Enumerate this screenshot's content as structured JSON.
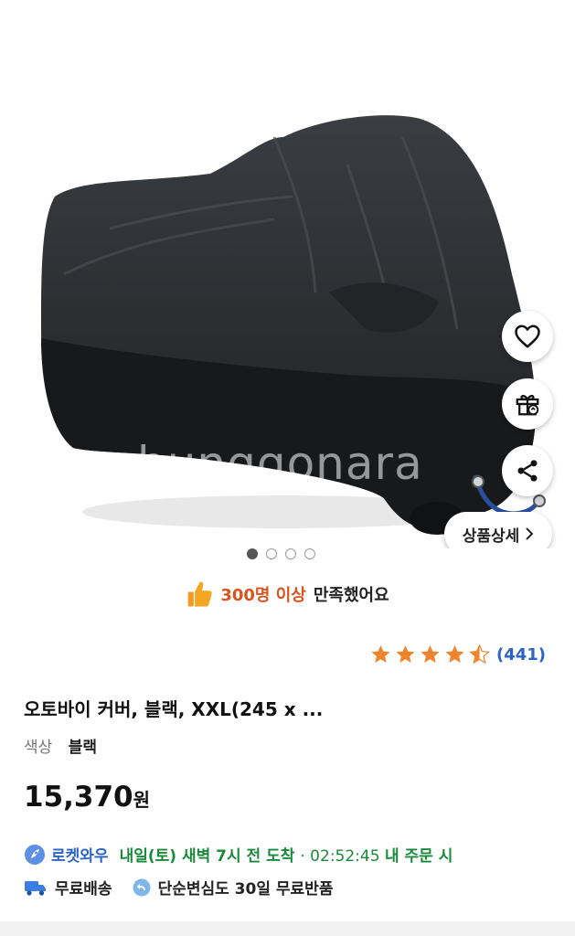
{
  "product": {
    "watermark": "bunggonara",
    "image_dots": [
      true,
      false,
      false,
      false
    ],
    "detail_button_label": "상품상세",
    "satisfaction": {
      "count_text": "300명 이상",
      "rest_text": "만족했어요"
    },
    "rating": {
      "value": 4.5,
      "max": 5,
      "review_count": "(441)"
    },
    "title": "오토바이 커버, 블랙, XXL(245 x ...",
    "option": {
      "label": "색상",
      "value": "블랙"
    },
    "price": {
      "amount": "15,370",
      "unit": "원"
    },
    "delivery": {
      "rocket_label": "로켓와우",
      "arrival": "내일(토) 새벽 7시 전 도착",
      "time_text": " · 02:52:45 ",
      "order_text": "내 주문 시"
    },
    "benefits": {
      "free_shipping": "무료배송",
      "return_text": "단순변심도 30일 무료반품"
    },
    "icons": [
      "heart-icon",
      "gift-icon",
      "share-icon",
      "chevron-right-icon",
      "thumbs-up-icon",
      "star-icon",
      "rocket-icon",
      "truck-icon",
      "return-icon"
    ],
    "colors": {
      "accent_blue": "#2b63c7",
      "green": "#1a8a3a",
      "orange": "#d9531e",
      "star": "#f0842c"
    }
  }
}
